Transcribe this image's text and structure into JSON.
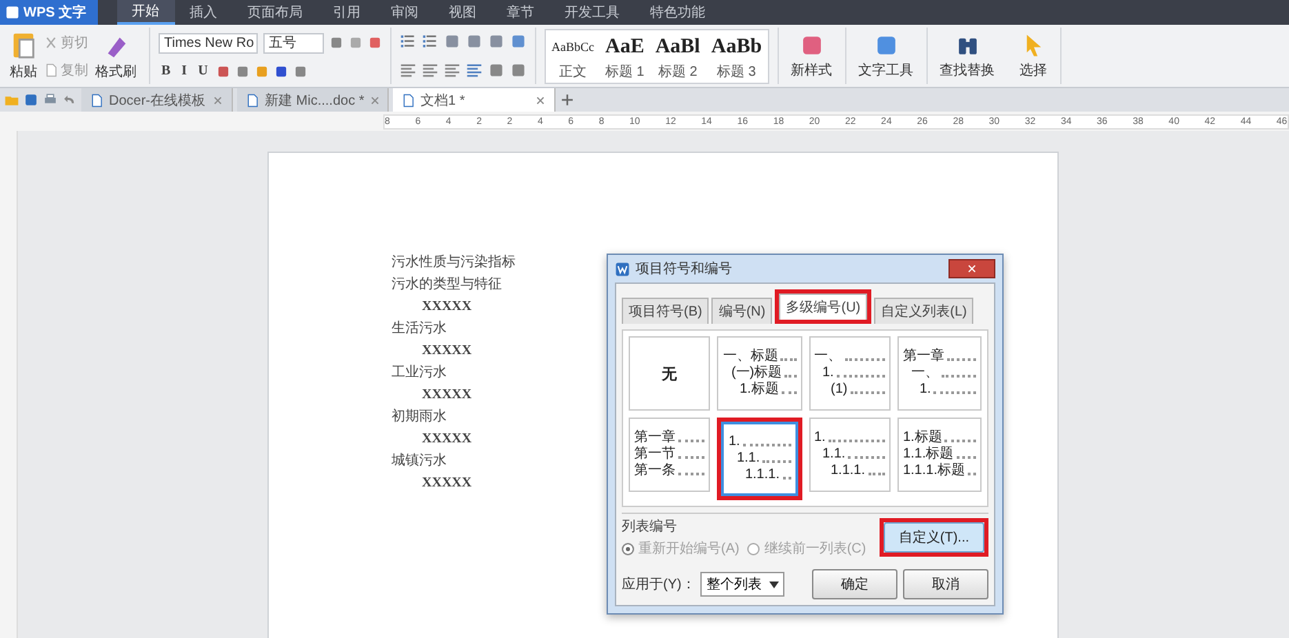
{
  "app_menu": {
    "label": "WPS 文字"
  },
  "menu_tabs": [
    {
      "label": "开始",
      "selected": true
    },
    {
      "label": "插入",
      "selected": false
    },
    {
      "label": "页面布局",
      "selected": false
    },
    {
      "label": "引用",
      "selected": false
    },
    {
      "label": "审阅",
      "selected": false
    },
    {
      "label": "视图",
      "selected": false
    },
    {
      "label": "章节",
      "selected": false
    },
    {
      "label": "开发工具",
      "selected": false
    },
    {
      "label": "特色功能",
      "selected": false
    }
  ],
  "ribbon": {
    "paste": "粘贴",
    "cut": "剪切",
    "copy": "复制",
    "format_painter": "格式刷",
    "font_name": "Times New Ro",
    "font_size": "五号",
    "format_buttons": [
      "B",
      "I",
      "U"
    ],
    "styles": [
      {
        "sample": "AaBbCc",
        "label": "正文"
      },
      {
        "sample": "AaE",
        "label": "标题 1"
      },
      {
        "sample": "AaBl",
        "label": "标题 2"
      },
      {
        "sample": "AaBb",
        "label": "标题 3"
      }
    ],
    "tools": [
      {
        "label": "新样式"
      },
      {
        "label": "文字工具"
      },
      {
        "label": "查找替换"
      },
      {
        "label": "选择"
      }
    ]
  },
  "doc_tabs": [
    {
      "label": "Docer-在线模板",
      "selected": false
    },
    {
      "label": "新建 Mic....doc *",
      "selected": false
    },
    {
      "label": "文档1 *",
      "selected": true
    }
  ],
  "ruler_labels": [
    "8",
    "6",
    "4",
    "2",
    "2",
    "4",
    "6",
    "8",
    "10",
    "12",
    "14",
    "16",
    "18",
    "20",
    "22",
    "24",
    "26",
    "28",
    "30",
    "32",
    "34",
    "36",
    "38",
    "40",
    "42",
    "44",
    "46"
  ],
  "document": {
    "lines": [
      {
        "text": "污水性质与污染指标"
      },
      {
        "text": "污水的类型与特征",
        "children": [
          {
            "text": "XXXXX"
          }
        ]
      },
      {
        "text": "生活污水",
        "children": [
          {
            "text": "XXXXX"
          }
        ]
      },
      {
        "text": "工业污水",
        "children": [
          {
            "text": "XXXXX"
          }
        ]
      },
      {
        "text": "初期雨水",
        "children": [
          {
            "text": "XXXXX"
          }
        ]
      },
      {
        "text": "城镇污水",
        "children": [
          {
            "text": "XXXXX"
          }
        ]
      }
    ]
  },
  "dialog": {
    "title": "项目符号和编号",
    "tabs": [
      {
        "label": "项目符号(B)",
        "selected": false,
        "highlighted": false
      },
      {
        "label": "编号(N)",
        "selected": false,
        "highlighted": false
      },
      {
        "label": "多级编号(U)",
        "selected": true,
        "highlighted": true
      },
      {
        "label": "自定义列表(L)",
        "selected": false,
        "highlighted": false
      }
    ],
    "presets": [
      {
        "label": "无",
        "selected": false,
        "highlighted": false
      },
      {
        "selected": false,
        "highlighted": false,
        "lines": [
          {
            "marker": "一、标题",
            "children": [
              {
                "marker": "(一)标题",
                "children": [
                  {
                    "marker": "1.标题"
                  }
                ]
              }
            ]
          }
        ]
      },
      {
        "selected": false,
        "highlighted": false,
        "lines": [
          {
            "marker": "一、",
            "children": [
              {
                "marker": "1.",
                "children": [
                  {
                    "marker": "(1)"
                  }
                ]
              }
            ]
          }
        ]
      },
      {
        "selected": false,
        "highlighted": false,
        "lines": [
          {
            "marker": "第一章",
            "children": [
              {
                "marker": "一、",
                "children": [
                  {
                    "marker": "1."
                  }
                ]
              }
            ]
          }
        ]
      },
      {
        "selected": false,
        "highlighted": false,
        "lines": [
          {
            "marker": "第一章"
          },
          {
            "marker": "第一节"
          },
          {
            "marker": "第一条"
          }
        ]
      },
      {
        "selected": true,
        "highlighted": true,
        "lines": [
          {
            "marker": "1.",
            "children": [
              {
                "marker": "1.1.",
                "children": [
                  {
                    "marker": "1.1.1."
                  }
                ]
              }
            ]
          }
        ]
      },
      {
        "selected": false,
        "highlighted": false,
        "lines": [
          {
            "marker": "1.",
            "children": [
              {
                "marker": "1.1.",
                "children": [
                  {
                    "marker": "1.1.1."
                  }
                ]
              }
            ]
          }
        ]
      },
      {
        "selected": false,
        "highlighted": false,
        "lines": [
          {
            "marker": "1.标题"
          },
          {
            "marker": "1.1.标题"
          },
          {
            "marker": "1.1.1.标题"
          }
        ]
      }
    ],
    "list_numbering": {
      "title": "列表编号",
      "options": [
        {
          "label": "重新开始编号(A)",
          "selected": true,
          "disabled": true
        },
        {
          "label": "继续前一列表(C)",
          "selected": false,
          "disabled": true
        }
      ]
    },
    "customize_button": {
      "label": "自定义(T)...",
      "highlighted": true
    },
    "apply_to": {
      "label": "应用于(Y)：",
      "value": "整个列表"
    },
    "ok": "确定",
    "cancel": "取消"
  }
}
